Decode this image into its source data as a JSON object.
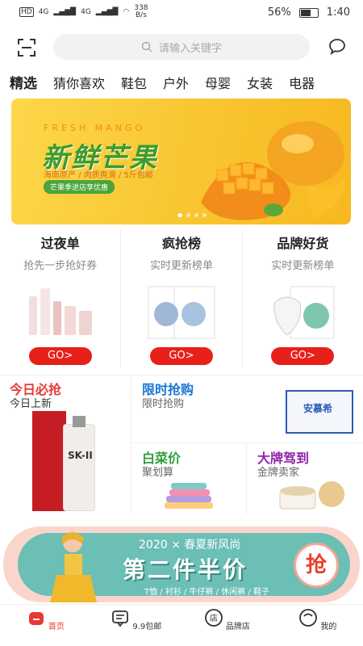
{
  "status": {
    "net1": "HD",
    "net2": "HD",
    "sig1": "4G",
    "sig2": "4G",
    "speed": "338",
    "speed_unit": "B/s",
    "battery": "56%",
    "battery_level": 0.56,
    "time": "1:40"
  },
  "header": {
    "search_placeholder": "请输入关键字"
  },
  "tabs": [
    "精选",
    "猜你喜欢",
    "鞋包",
    "户外",
    "母婴",
    "女装",
    "电器"
  ],
  "banner": {
    "en_title": "FRESH MANGO",
    "cn_title": "新鲜芒果",
    "subtitle": "海南原产 / 肉质爽滑 / 5斤包邮",
    "pill": "芒果季进店享优惠"
  },
  "cards": [
    {
      "title": "过夜单",
      "subtitle": "抢先一步抢好券",
      "button": "GO>"
    },
    {
      "title": "疯抢榜",
      "subtitle": "实时更新榜单",
      "button": "GO>"
    },
    {
      "title": "品牌好货",
      "subtitle": "实时更新榜单",
      "button": "GO>"
    }
  ],
  "grid": {
    "big": {
      "title": "今日必抢",
      "subtitle": "今日上新",
      "color": "#e53935",
      "product": "SK-II"
    },
    "top": {
      "title": "限时抢购",
      "subtitle": "限时抢购",
      "color": "#1976d2",
      "product": "安慕希"
    },
    "bl": {
      "title": "白菜价",
      "subtitle": "聚划算",
      "color": "#2e9f3a"
    },
    "br": {
      "title": "大牌驾到",
      "subtitle": "金牌卖家",
      "color": "#8e24aa"
    }
  },
  "promo": {
    "line1": "2020 × 春夏新风尚",
    "line2": "第二件半价",
    "line3": "T恤 / 衬衫 / 牛仔裤 / 休闲裤 / 鞋子",
    "badge": "抢"
  },
  "nav": [
    {
      "label": "首页",
      "icon": "home-icon",
      "active": true
    },
    {
      "label": "9.9包邮",
      "icon": "message-icon",
      "active": false
    },
    {
      "label": "品牌店",
      "icon": "store-icon",
      "active": false
    },
    {
      "label": "我的",
      "icon": "profile-icon",
      "active": false
    }
  ],
  "colors": {
    "accent": "#e53935",
    "go_button": "#e8201a"
  }
}
